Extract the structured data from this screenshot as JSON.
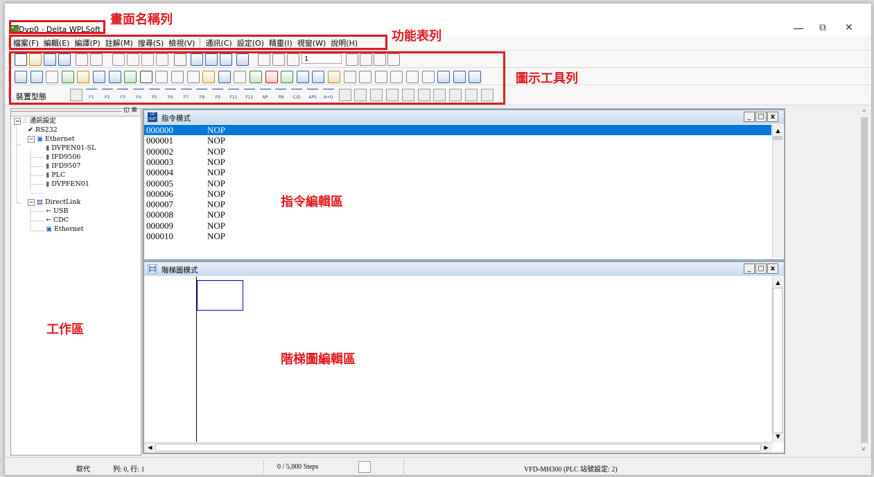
{
  "window": {
    "title": "Dvp0 - Delta WPLSoft",
    "controls": [
      "—",
      "⧉",
      "✕"
    ]
  },
  "menu": [
    "檔案(F)",
    "編輯(E)",
    "編譯(P)",
    "註解(M)",
    "搜尋(S)",
    "檢視(V)",
    "|",
    "通訊(C)",
    "設定(O)",
    "精靈(I)",
    "視窗(W)",
    "說明(H)"
  ],
  "toolbar": {
    "step_value": "1",
    "device_label": "裝置型態",
    "fkeys": [
      "F1",
      "F2",
      "F3",
      "F4",
      "F5",
      "F6",
      "F7",
      "F8",
      "F9",
      "F11",
      "F12",
      "NP",
      "PN",
      "C/D",
      "APS",
      "A+D"
    ]
  },
  "annotations": {
    "title_bar": "畫面名稱列",
    "menu_bar": "功能表列",
    "toolbar": "圖示工具列",
    "instruction_area": "指令編輯區",
    "work_area": "工作區",
    "ladder_area": "階梯圖編輯區"
  },
  "tree": {
    "root": "通訊設定",
    "rs232": "RS232",
    "ethernet": "Ethernet",
    "eth_children": [
      "DVPEN01-SL",
      "IFD9506",
      "IFD9507",
      "PLC",
      "DVPFEN01"
    ],
    "directlink": "DirectLink",
    "dl_children": [
      "USB",
      "CDC",
      "Ethernet"
    ]
  },
  "instruction_window": {
    "title": "指令模式",
    "icon_text": "LD OUT",
    "rows": [
      {
        "addr": "000000",
        "op": "NOP"
      },
      {
        "addr": "000001",
        "op": "NOP"
      },
      {
        "addr": "000002",
        "op": "NOP"
      },
      {
        "addr": "000003",
        "op": "NOP"
      },
      {
        "addr": "000004",
        "op": "NOP"
      },
      {
        "addr": "000005",
        "op": "NOP"
      },
      {
        "addr": "000006",
        "op": "NOP"
      },
      {
        "addr": "000007",
        "op": "NOP"
      },
      {
        "addr": "000008",
        "op": "NOP"
      },
      {
        "addr": "000009",
        "op": "NOP"
      },
      {
        "addr": "000010",
        "op": "NOP"
      }
    ]
  },
  "ladder_window": {
    "title": "階梯圖模式"
  },
  "mdi_buttons": [
    "_",
    "□",
    "x"
  ],
  "status": {
    "mode": "取代",
    "position": "列: 0, 行: 1",
    "steps": "0 / 5,000 Steps",
    "device": "VFD-MH300 (PLC 站號設定: 2)"
  },
  "colors": {
    "annotation_red": "#e0191f",
    "selection_blue": "#0078d7"
  }
}
